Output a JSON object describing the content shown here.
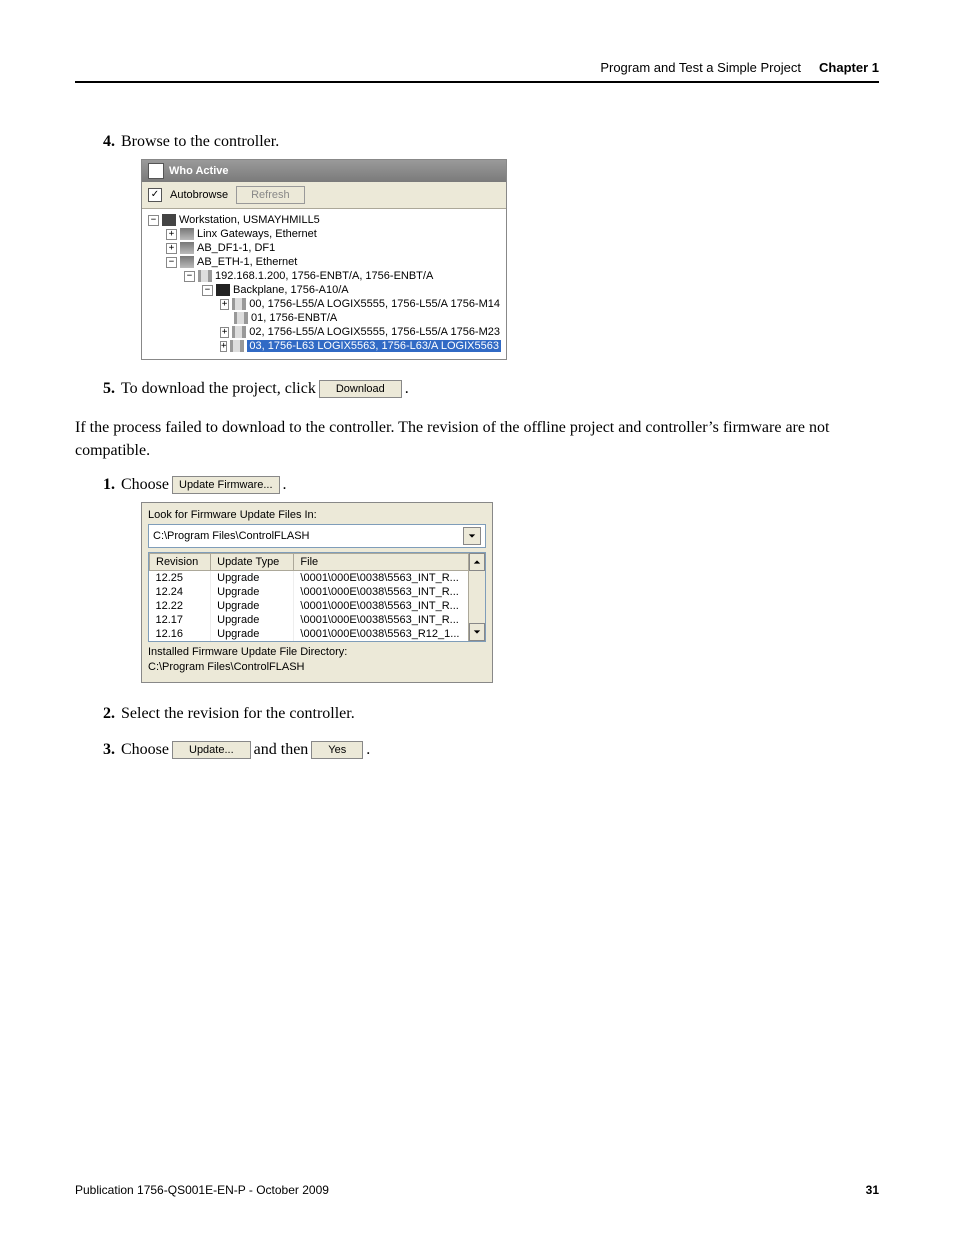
{
  "header": {
    "section": "Program and Test a Simple Project",
    "chapter": "Chapter 1"
  },
  "step4": {
    "num": "4.",
    "text": "Browse to the controller."
  },
  "who": {
    "title": "Who Active",
    "autobrowse": "Autobrowse",
    "refresh": "Refresh",
    "tree": {
      "n0": "Workstation, USMAYHMILL5",
      "n1": "Linx Gateways, Ethernet",
      "n2": "AB_DF1-1, DF1",
      "n3": "AB_ETH-1, Ethernet",
      "n4": "192.168.1.200, 1756-ENBT/A, 1756-ENBT/A",
      "n5": "Backplane, 1756-A10/A",
      "n6": "00, 1756-L55/A LOGIX5555, 1756-L55/A 1756-M14",
      "n7": "01, 1756-ENBT/A",
      "n8": "02, 1756-L55/A LOGIX5555, 1756-L55/A 1756-M23",
      "n9": "03, 1756-L63 LOGIX5563, 1756-L63/A LOGIX5563"
    }
  },
  "step5": {
    "num": "5.",
    "pre": "To download the project, click",
    "btn": "Download",
    "post": "."
  },
  "para": "If the process failed to download to the controller. The revision of the offline project and controller’s firmware are not compatible.",
  "step1": {
    "num": "1.",
    "pre": "Choose",
    "btn": "Update Firmware...",
    "post": "."
  },
  "cf": {
    "look": "Look for Firmware Update Files In:",
    "path": "C:\\Program Files\\ControlFLASH",
    "h1": "Revision",
    "h2": "Update Type",
    "h3": "File",
    "rows": [
      {
        "r": "12.25",
        "t": "Upgrade",
        "f": "\\0001\\000E\\0038\\5563_INT_R..."
      },
      {
        "r": "12.24",
        "t": "Upgrade",
        "f": "\\0001\\000E\\0038\\5563_INT_R..."
      },
      {
        "r": "12.22",
        "t": "Upgrade",
        "f": "\\0001\\000E\\0038\\5563_INT_R..."
      },
      {
        "r": "12.17",
        "t": "Upgrade",
        "f": "\\0001\\000E\\0038\\5563_INT_R..."
      },
      {
        "r": "12.16",
        "t": "Upgrade",
        "f": "\\0001\\000E\\0038\\5563_R12_1..."
      }
    ],
    "inst": "Installed Firmware Update File Directory:",
    "dir": "C:\\Program Files\\ControlFLASH"
  },
  "step2": {
    "num": "2.",
    "text": "Select the revision for the controller."
  },
  "step3": {
    "num": "3.",
    "pre": "Choose",
    "btn1": "Update...",
    "mid": "and then",
    "btn2": "Yes",
    "post": "."
  },
  "footer": {
    "pub": "Publication 1756-QS001E-EN-P - October 2009",
    "page": "31"
  },
  "chart_data": null
}
